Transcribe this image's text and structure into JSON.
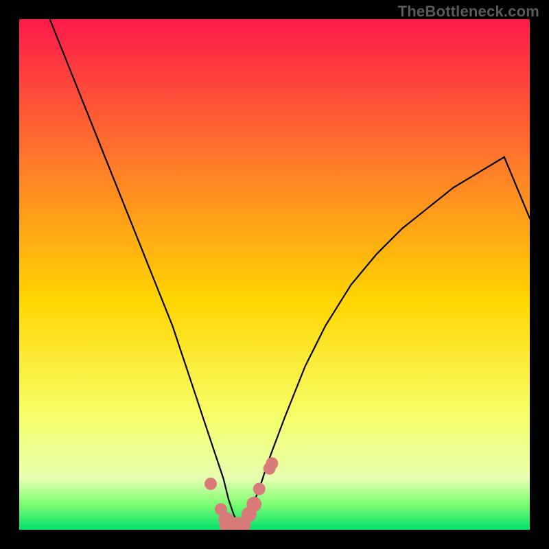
{
  "watermark": "TheBottleneck.com",
  "chart_data": {
    "type": "line",
    "title": "",
    "xlabel": "",
    "ylabel": "",
    "xlim": [
      0,
      100
    ],
    "ylim": [
      0,
      100
    ],
    "grid": false,
    "series": [
      {
        "name": "bottleneck-curve",
        "x": [
          6,
          10,
          14,
          18,
          22,
          26,
          30,
          32,
          34,
          36,
          38,
          40,
          41,
          42,
          43,
          44,
          45,
          47,
          49,
          52,
          56,
          60,
          65,
          70,
          75,
          80,
          85,
          90,
          95,
          100
        ],
        "y": [
          100,
          90,
          80,
          70,
          60,
          50,
          40,
          34,
          28,
          22,
          16,
          10,
          6,
          3,
          1,
          1,
          3,
          8,
          14,
          22,
          32,
          40,
          48,
          54,
          59,
          63,
          67,
          70,
          73,
          61
        ]
      },
      {
        "name": "marker-dots",
        "x": [
          37.5,
          39.5,
          40.5,
          41.5,
          42.5,
          43.5,
          45,
          46,
          47,
          49,
          49.5
        ],
        "y": [
          9,
          4,
          2,
          1,
          1,
          1,
          3,
          5,
          8,
          12,
          13
        ]
      }
    ],
    "background_gradient": {
      "top": "#ff1a4a",
      "mid_upper": "#ff7a2a",
      "mid": "#ffd500",
      "mid_lower": "#f7ff6a",
      "green_band": "#7dfc72",
      "bottom": "#00e26a"
    }
  }
}
